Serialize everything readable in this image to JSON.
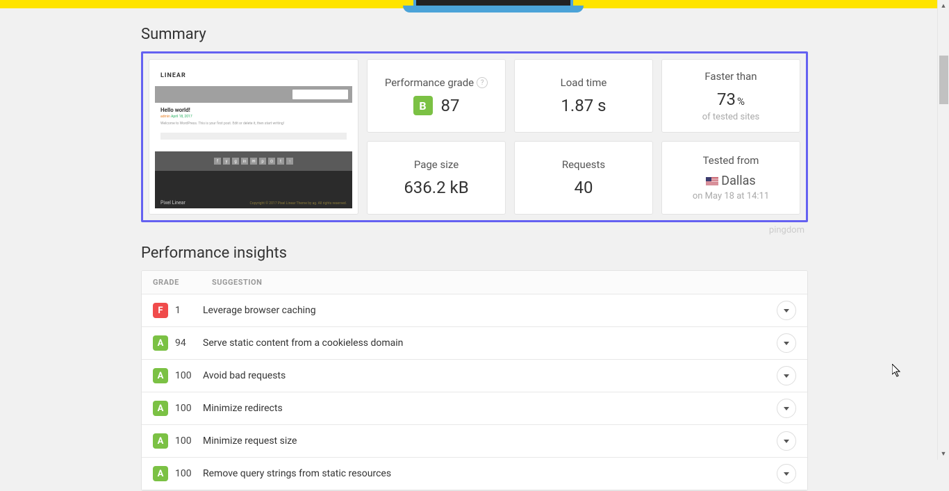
{
  "summary": {
    "title": "Summary",
    "screenshot": {
      "logo": "LINEAR",
      "content_title": "Hello world!",
      "content_meta_author": "admin",
      "content_meta_date": "April 18, 2017",
      "content_text": "Welcome to WordPress. This is your first post. Edit or delete it, then start writing!",
      "footer_left": "Pixel Linear",
      "footer_right": "Copyright © 2017 Pixel Linear Theme by ag. All rights reserved."
    },
    "metrics": {
      "performance": {
        "label": "Performance grade",
        "grade": "B",
        "score": "87"
      },
      "load_time": {
        "label": "Load time",
        "value": "1.87 s"
      },
      "faster_than": {
        "label": "Faster than",
        "value": "73",
        "unit": "%",
        "sub": "of tested sites"
      },
      "page_size": {
        "label": "Page size",
        "value": "636.2 kB"
      },
      "requests": {
        "label": "Requests",
        "value": "40"
      },
      "tested_from": {
        "label": "Tested from",
        "location": "Dallas",
        "timestamp": "on May 18 at 14:11"
      }
    },
    "brand": "pingdom"
  },
  "insights": {
    "title": "Performance insights",
    "headers": {
      "grade": "Grade",
      "suggestion": "Suggestion"
    },
    "rows": [
      {
        "grade": "F",
        "score": "1",
        "text": "Leverage browser caching"
      },
      {
        "grade": "A",
        "score": "94",
        "text": "Serve static content from a cookieless domain"
      },
      {
        "grade": "A",
        "score": "100",
        "text": "Avoid bad requests"
      },
      {
        "grade": "A",
        "score": "100",
        "text": "Minimize redirects"
      },
      {
        "grade": "A",
        "score": "100",
        "text": "Minimize request size"
      },
      {
        "grade": "A",
        "score": "100",
        "text": "Remove query strings from static resources"
      }
    ]
  }
}
